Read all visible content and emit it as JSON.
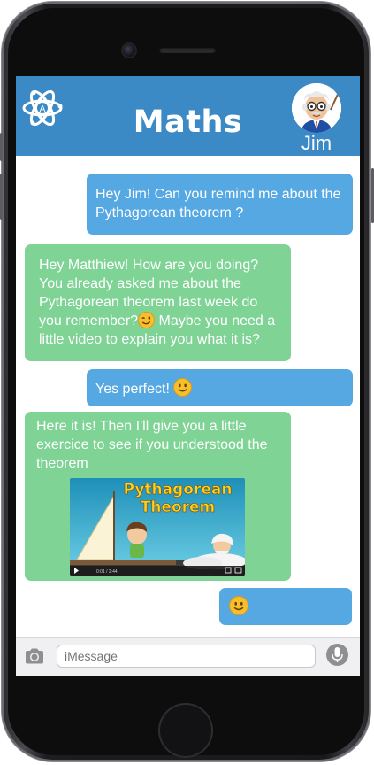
{
  "header": {
    "title": "Maths",
    "contact_name": "Jim",
    "app_icon": "atom-icon",
    "avatar_icon": "teacher-avatar"
  },
  "messages": [
    {
      "side": "sent",
      "text": "Hey Jim! Can you remind me about the Pythagorean theorem ?"
    },
    {
      "side": "received",
      "text_before": "Hey Matthiew! How are you doing? You already asked me about the Pythagorean theorem last week do you remember?",
      "emoji": "winking-face",
      "text_after": "Maybe you need a little video to explain you what it is?"
    },
    {
      "side": "sent",
      "text": "Yes perfect!",
      "emoji": "smiling-face"
    },
    {
      "side": "received",
      "text": "Here it is! Then I'll give you a little exercice to see if you understood the theorem",
      "video": {
        "title_line1": "Pythagorean",
        "title_line2": "Theorem",
        "time": "0:01 / 2:44"
      }
    },
    {
      "side": "sent",
      "emoji": "smiling-face"
    }
  ],
  "composer": {
    "placeholder": "iMessage",
    "camera_icon": "camera-icon",
    "mic_icon": "microphone-icon"
  },
  "colors": {
    "header": "#3b8ac6",
    "sent_bubble": "#56a8e3",
    "received_bubble": "#7ed395"
  }
}
